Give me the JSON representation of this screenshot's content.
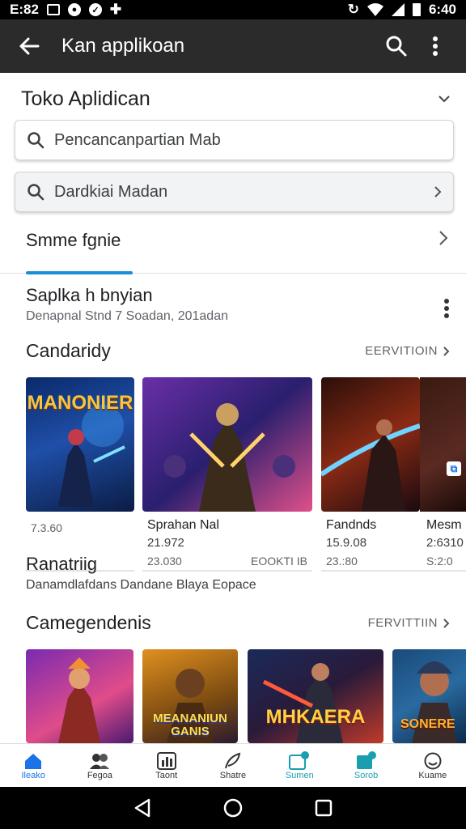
{
  "status_bar": {
    "time_left": "E:82",
    "time_right": "6:40"
  },
  "app_bar": {
    "title": "Kan applikoan"
  },
  "store": {
    "title": "Toko Aplidican"
  },
  "search": {
    "placeholder": "Pencancanpartian Mab",
    "alt": "Dardkiai Madan"
  },
  "tab": {
    "label": "Smme fgnie"
  },
  "featured": {
    "name": "Saplka h bnyian",
    "sub": "Denapnal Stnd 7 Soadan, 201adan"
  },
  "section1": {
    "title": "Candaridy",
    "more": "EERVITIOIN",
    "cards": [
      {
        "art_title": "MANONIER",
        "title": "",
        "number": "",
        "price_left": "7.3.60",
        "price_right": ""
      },
      {
        "art_title": "",
        "title": "Sprahan Nal",
        "number": "21.972",
        "price_left": "23.030",
        "price_right": "EOOKTI IB"
      },
      {
        "art_title": "",
        "title": "Fandnds",
        "number": "15.9.08",
        "price_left": "23.:80",
        "price_right": ""
      },
      {
        "art_title": "",
        "title": "Mesm",
        "number": "2:6310",
        "price_left": "S:2:0",
        "price_right": ""
      }
    ]
  },
  "promo": {
    "name": "Ranatriig",
    "sub": "Danamdlafdans Dandane Blaya Eopace"
  },
  "section2": {
    "title": "Camegendenis",
    "more": "FERVITTIIN",
    "cards": [
      {
        "art_title": ""
      },
      {
        "art_title": "MEANANIUN GANIS"
      },
      {
        "art_title": "MHKAERA"
      },
      {
        "art_title": "SONERE"
      }
    ]
  },
  "bottom_nav": [
    {
      "label": "Ileako",
      "icon": "home-icon"
    },
    {
      "label": "Fegoa",
      "icon": "people-icon"
    },
    {
      "label": "Taont",
      "icon": "chart-icon"
    },
    {
      "label": "Shatre",
      "icon": "feather-icon"
    },
    {
      "label": "Sumen",
      "icon": "download-icon"
    },
    {
      "label": "Sorob",
      "icon": "gallery-icon"
    },
    {
      "label": "Kuame",
      "icon": "smiley-icon"
    }
  ],
  "colors": {
    "accent": "#1a8fd6",
    "app_bar": "#2b2b2b"
  }
}
